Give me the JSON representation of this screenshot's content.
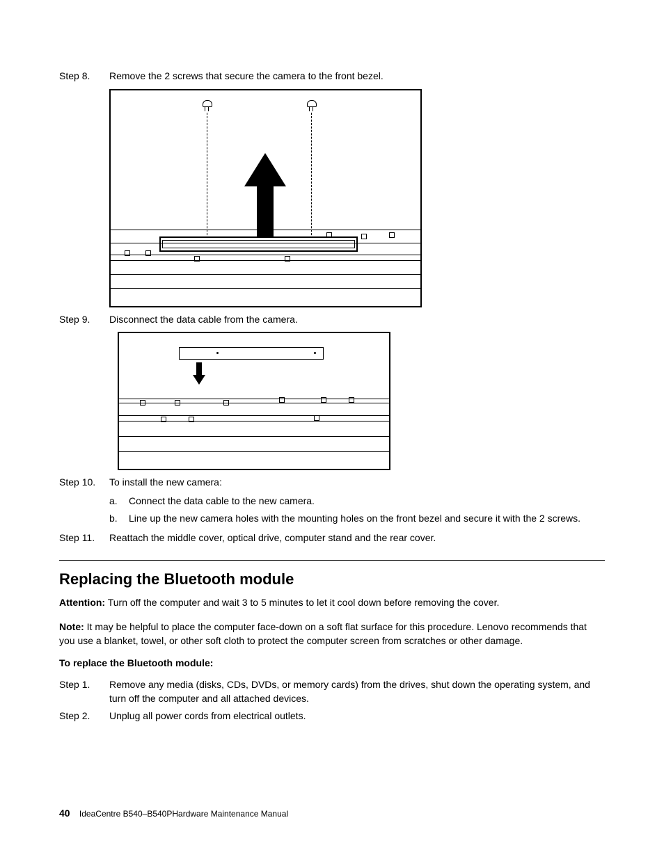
{
  "steps_top": [
    {
      "label": "Step 8.",
      "text": "Remove the 2 screws that secure the camera to the front bezel."
    },
    {
      "label": "Step 9.",
      "text": "Disconnect the data cable from the camera."
    },
    {
      "label": "Step 10.",
      "text": "To install the new camera:"
    }
  ],
  "substeps_10": [
    {
      "label": "a.",
      "text": "Connect the data cable to the new camera."
    },
    {
      "label": "b.",
      "text": "Line up the new camera holes with the mounting holes on the front bezel and secure it with the 2 screws."
    }
  ],
  "step11": {
    "label": "Step 11.",
    "text": "Reattach the middle cover, optical drive, computer stand and the rear cover."
  },
  "section": {
    "title": "Replacing the Bluetooth module",
    "attention_label": "Attention:",
    "attention_text": " Turn off the computer and wait 3 to 5 minutes to let it cool down before removing the cover.",
    "note_label": "Note:",
    "note_text": " It may be helpful to place the computer face-down on a soft flat surface for this procedure. Lenovo recommends that you use a blanket, towel, or other soft cloth to protect the computer screen from scratches or other damage.",
    "subhead": "To replace the Bluetooth module:",
    "steps": [
      {
        "label": "Step 1.",
        "text": "Remove any media (disks, CDs, DVDs, or memory cards) from the drives, shut down the operating system, and turn off the computer and all attached devices."
      },
      {
        "label": "Step 2.",
        "text": "Unplug all power cords from electrical outlets."
      }
    ]
  },
  "footer": {
    "page_number": "40",
    "doc_title": "IdeaCentre B540–B540PHardware Maintenance Manual"
  }
}
